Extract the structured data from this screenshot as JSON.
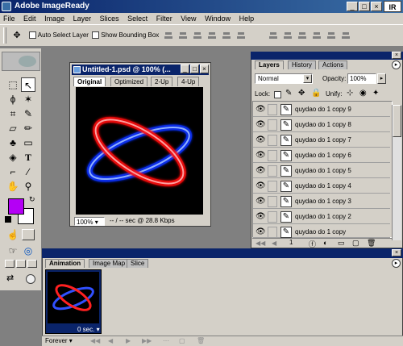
{
  "app": {
    "title": "Adobe ImageReady",
    "logo": "IR"
  },
  "window_buttons": {
    "minimize": "_",
    "maximize": "□",
    "close": "×"
  },
  "menu": [
    "File",
    "Edit",
    "Image",
    "Layer",
    "Slices",
    "Select",
    "Filter",
    "View",
    "Window",
    "Help"
  ],
  "options_bar": {
    "auto_select_label": "Auto Select Layer",
    "show_bounding_label": "Show Bounding Box"
  },
  "document": {
    "title": "Untitled-1.psd @ 100% (...",
    "tabs": [
      "Original",
      "Optimized",
      "2-Up",
      "4-Up"
    ],
    "active_tab": "Original",
    "zoom": "100%",
    "status": "-- / -- sec @ 28.8 Kbps"
  },
  "layers_palette": {
    "tabs": [
      "Layers",
      "History",
      "Actions"
    ],
    "active_tab": "Layers",
    "blend_mode": "Normal",
    "opacity_label": "Opacity:",
    "opacity_value": "100%",
    "lock_label": "Lock:",
    "unify_label": "Unify:",
    "layers": [
      "quydao do 1 copy 9",
      "quydao do 1 copy 8",
      "quydao do 1 copy 7",
      "quydao do 1 copy 6",
      "quydao do 1 copy 5",
      "quydao do 1 copy 4",
      "quydao do 1 copy 3",
      "quydao do 1 copy 2",
      "quydao do 1 copy"
    ],
    "footer_number": "1"
  },
  "animation_palette": {
    "tabs": [
      "Animation",
      "Image Map",
      "Slice"
    ],
    "active_tab": "Animation",
    "frame_number": "1",
    "frame_delay": "0 sec.",
    "loop": "Forever"
  },
  "colors": {
    "foreground": "#b400f5",
    "background": "#ffffff",
    "titlebar": "#0a246a"
  }
}
